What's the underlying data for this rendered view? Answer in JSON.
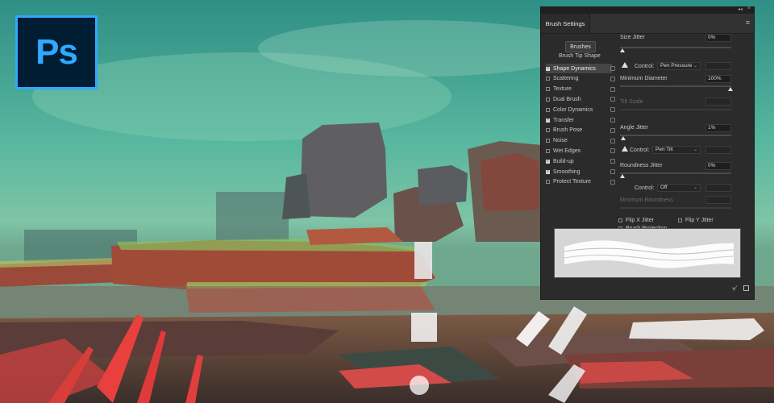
{
  "app": {
    "logo_text": "Ps",
    "accent": "#31a8ff"
  },
  "panel": {
    "title": "Brush Settings",
    "brushes_button": "Brushes",
    "tip_shape_label": "Brush Tip Shape",
    "options": [
      {
        "label": "Shape Dynamics",
        "checked": true,
        "active": true
      },
      {
        "label": "Scattering",
        "checked": false
      },
      {
        "label": "Texture",
        "checked": false
      },
      {
        "label": "Dual Brush",
        "checked": false
      },
      {
        "label": "Color Dynamics",
        "checked": false
      },
      {
        "label": "Transfer",
        "checked": true
      },
      {
        "label": "Brush Pose",
        "checked": false
      },
      {
        "label": "Noise",
        "checked": false
      },
      {
        "label": "Wet Edges",
        "checked": false
      },
      {
        "label": "Build-up",
        "checked": true
      },
      {
        "label": "Smoothing",
        "checked": true
      },
      {
        "label": "Protect Texture",
        "checked": false
      }
    ],
    "size_jitter": {
      "label": "Size Jitter",
      "value": "0%",
      "slider": 0
    },
    "control1": {
      "label": "Control:",
      "value": "Pen Pressure"
    },
    "min_diameter": {
      "label": "Minimum Diameter",
      "value": "100%",
      "slider": 1
    },
    "tilt_scale": {
      "label": "Tilt Scale"
    },
    "angle_jitter": {
      "label": "Angle Jitter",
      "value": "1%",
      "slider": 0.01
    },
    "control2": {
      "label": "Control:",
      "value": "Pen Tilt"
    },
    "roundness_jitter": {
      "label": "Roundness Jitter",
      "value": "0%",
      "slider": 0
    },
    "control3": {
      "label": "Control:",
      "value": "Off"
    },
    "min_roundness": {
      "label": "Minimum Roundness"
    },
    "flip_x": {
      "label": "Flip X Jitter",
      "checked": false
    },
    "flip_y": {
      "label": "Flip Y Jitter",
      "checked": false
    },
    "brush_projection": {
      "label": "Brush Projection",
      "checked": false
    }
  }
}
